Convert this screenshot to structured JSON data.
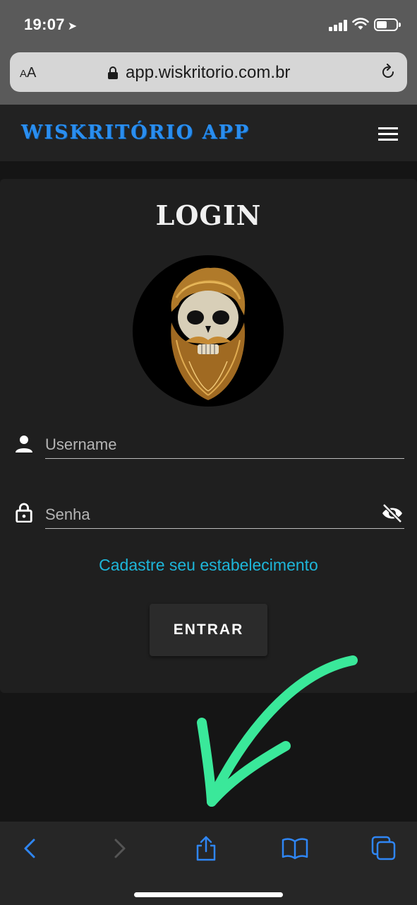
{
  "status_bar": {
    "time": "19:07",
    "location_glyph": "➤"
  },
  "browser": {
    "text_size_label_small": "A",
    "text_size_label_large": "A",
    "url": "app.wiskritorio.com.br",
    "icons": [
      "text-size-icon",
      "lock-icon",
      "reload-icon"
    ]
  },
  "header": {
    "brand": "WISKRITÓRIO APP",
    "brand_color": "#2a8ef0",
    "menu_icon": "hamburger-menu-icon"
  },
  "login": {
    "title": "LOGIN",
    "avatar_alt": "bearded skull",
    "username_placeholder": "Username",
    "password_placeholder": "Senha",
    "register_link": "Cadastre seu estabelecimento",
    "register_color": "#1eb6d9",
    "submit_label": "ENTRAR"
  },
  "annotation": {
    "arrow_color": "#3ae89a"
  },
  "toolbar": {
    "buttons": [
      "back-icon",
      "forward-icon",
      "share-icon",
      "bookmarks-icon",
      "tabs-icon"
    ],
    "accent": "#2f86f5"
  }
}
